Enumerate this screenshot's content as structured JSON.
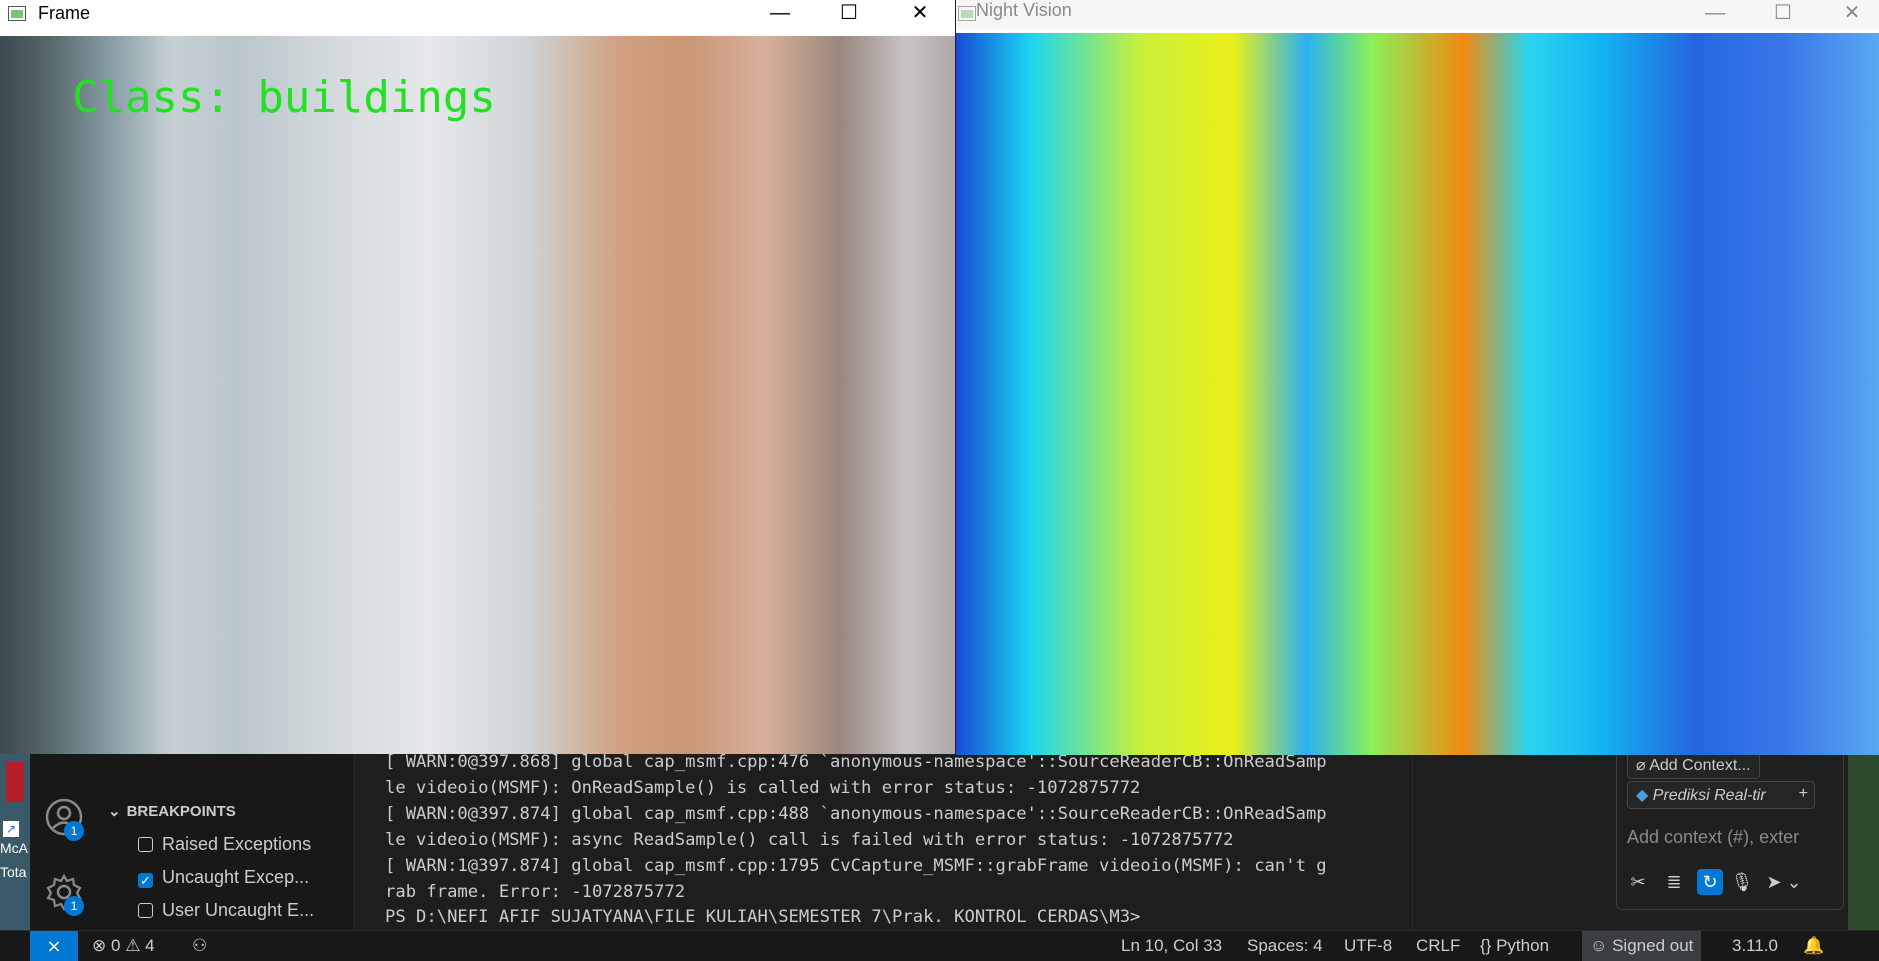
{
  "frame_window": {
    "title": "Frame",
    "class_label": "Class: buildings"
  },
  "night_window": {
    "title": "Night Vision"
  },
  "window_controls": {
    "minimize": "—",
    "maximize": "☐",
    "close": "✕"
  },
  "desktop": {
    "text1": "McA",
    "text2": "Tota"
  },
  "activity_bar": {
    "account_badge": "1",
    "settings_badge": "1"
  },
  "breakpoints": {
    "title": "BREAKPOINTS",
    "items": [
      {
        "label": "Raised Exceptions",
        "checked": false
      },
      {
        "label": "Uncaught Excep...",
        "checked": true
      },
      {
        "label": "User Uncaught E...",
        "checked": false
      }
    ]
  },
  "terminal": {
    "lines": [
      "[ WARN:0@397.868] global cap_msmf.cpp:476 `anonymous-namespace'::SourceReaderCB::OnReadSamp",
      "le videoio(MSMF): OnReadSample() is called with error status: -1072875772",
      "[ WARN:0@397.874] global cap_msmf.cpp:488 `anonymous-namespace'::SourceReaderCB::OnReadSamp",
      "le videoio(MSMF): async ReadSample() call is failed with error status: -1072875772",
      "[ WARN:1@397.874] global cap_msmf.cpp:1795 CvCapture_MSMF::grabFrame videoio(MSMF): can't g",
      "rab frame. Error: -1072875772",
      "PS D:\\NEFI AFIF SUJATYANA\\FILE KULIAH\\SEMESTER 7\\Prak. KONTROL CERDAS\\M3>"
    ]
  },
  "chat": {
    "add_context": "Add Context...",
    "file_chip": "Prediksi Real-tir",
    "placeholder": "Add context (#), exter"
  },
  "statusbar": {
    "errors": "0",
    "warnings": "4",
    "position": "Ln 10, Col 33",
    "spaces": "Spaces: 4",
    "encoding": "UTF-8",
    "eol": "CRLF",
    "language": "Python",
    "account": "Signed out",
    "version": "3.11.0"
  },
  "colors": {
    "accent": "#0078d4",
    "label_green": "#22e022"
  }
}
